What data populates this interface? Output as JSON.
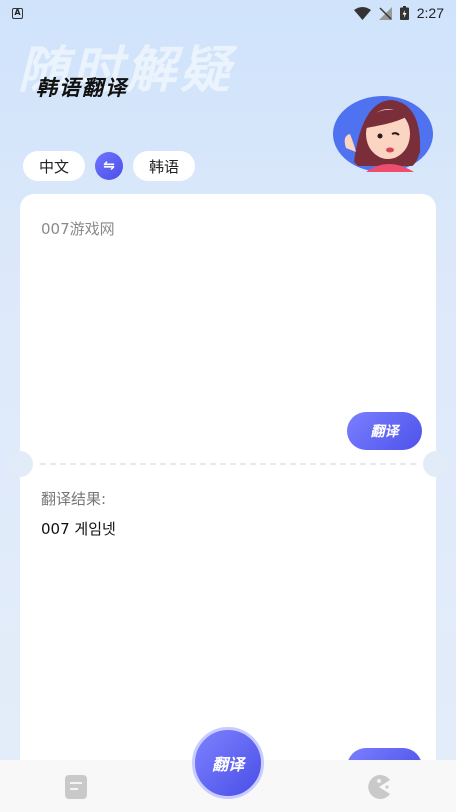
{
  "status_bar": {
    "time": "2:27"
  },
  "header": {
    "watermark": "随时解疑",
    "title": "韩语翻译"
  },
  "language": {
    "source": "中文",
    "target": "韩语",
    "swap_icon": "swap-icon"
  },
  "input": {
    "text": "007游戏网",
    "translate_label": "翻译"
  },
  "result": {
    "label": "翻译结果:",
    "text": "007 게임넷"
  },
  "bottom_nav": {
    "center_label": "翻译",
    "left_icon": "document-icon",
    "right_icon": "pacman-icon"
  },
  "colors": {
    "accent": "#5a5ef0",
    "background": "#d6e6fa"
  }
}
